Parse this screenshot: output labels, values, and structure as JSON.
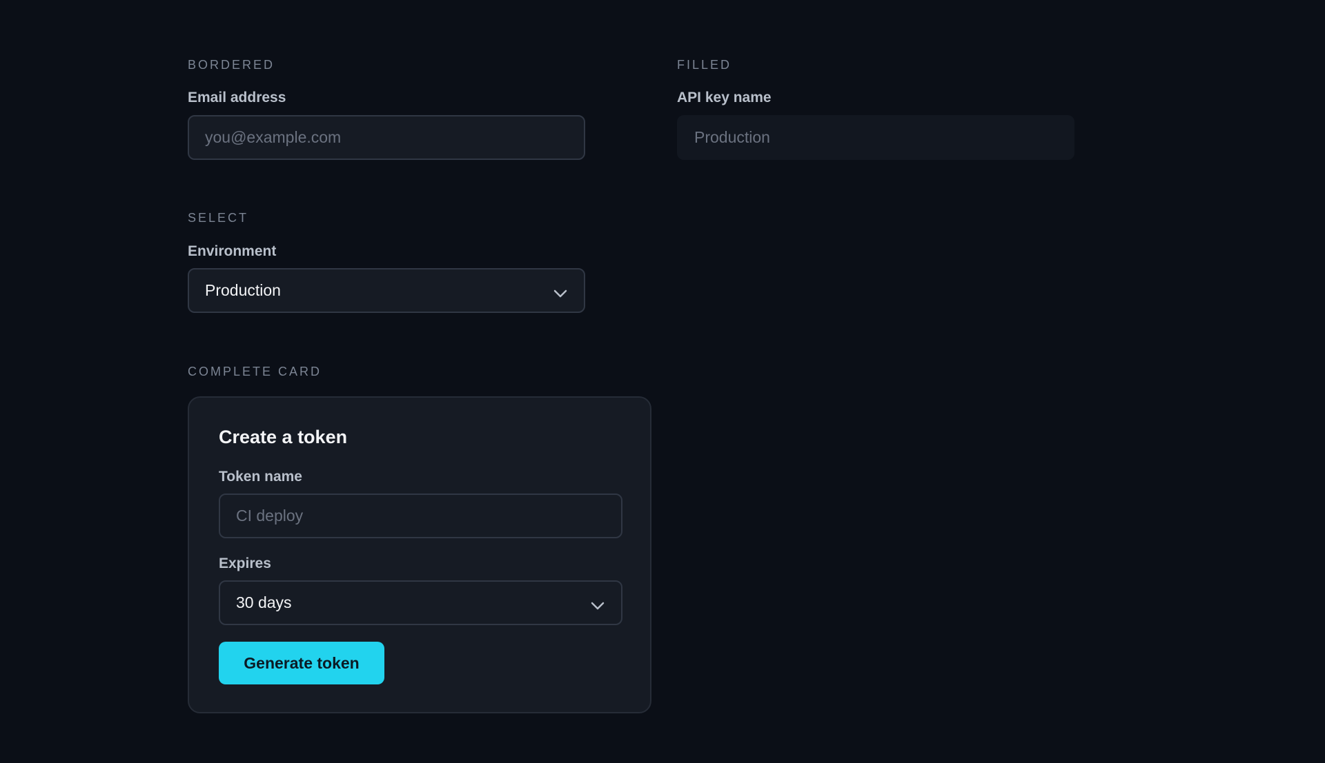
{
  "bordered": {
    "section_label": "BORDERED",
    "field_label": "Email address",
    "placeholder": "you@example.com"
  },
  "filled": {
    "section_label": "FILLED",
    "field_label": "API key name",
    "placeholder": "Production"
  },
  "select": {
    "section_label": "SELECT",
    "field_label": "Environment",
    "value": "Production",
    "icon": "chevron-down-icon"
  },
  "complete_card": {
    "section_label": "COMPLETE CARD",
    "title": "Create a token",
    "token_name_label": "Token name",
    "token_name_placeholder": "CI deploy",
    "expires_label": "Expires",
    "expires_value": "30 days",
    "button_label": "Generate token"
  },
  "colors": {
    "background": "#0b0f17",
    "accent": "#22d3ee",
    "input_border": "#303744",
    "input_bg": "#161b24"
  }
}
